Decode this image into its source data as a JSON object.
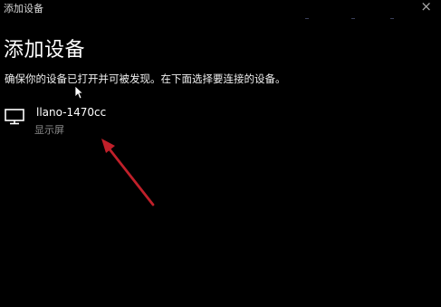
{
  "window": {
    "title": "添加设备",
    "close_glyph": "×"
  },
  "main": {
    "heading": "添加设备",
    "instruction": "确保你的设备已打开并可被发现。在下面选择要连接的设备。"
  },
  "devices": [
    {
      "name": "llano-1470cc",
      "type": "显示屏",
      "icon": "monitor-icon"
    }
  ],
  "annotation": {
    "arrow_color": "#c0202a"
  }
}
